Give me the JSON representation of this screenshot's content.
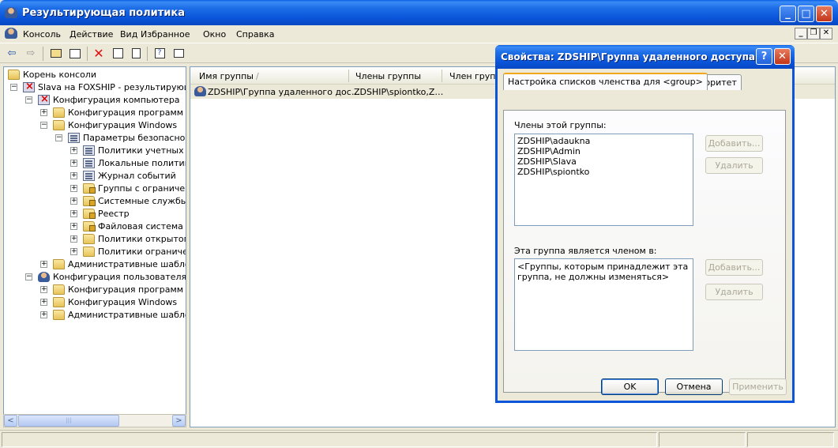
{
  "window": {
    "title": "Результирующая политика",
    "controls": [
      "_",
      "□",
      "✕"
    ]
  },
  "menubar": {
    "items": [
      "Консоль",
      "Действие",
      "Вид",
      "Избранное",
      "Окно",
      "Справка"
    ],
    "mdi_controls": [
      "_",
      "❐",
      "✕"
    ]
  },
  "toolbar": {
    "icons": [
      "back-arrow-icon",
      "forward-arrow-icon",
      "up-folder-icon",
      "show-tree-icon",
      "delete-icon",
      "properties-icon",
      "export-icon",
      "help-icon",
      "console-view-icon"
    ]
  },
  "tree": {
    "nodes": [
      {
        "label": "Корень консоли",
        "icon": "folder",
        "level": 0,
        "expander": ""
      },
      {
        "label": "Slava на FOXSHIP - результирующая",
        "icon": "pc-red",
        "level": 0,
        "expander": "−"
      },
      {
        "label": "Конфигурация компьютера",
        "icon": "pc-red",
        "level": 1,
        "expander": "−"
      },
      {
        "label": "Конфигурация программ",
        "icon": "folder",
        "level": 2,
        "expander": "+"
      },
      {
        "label": "Конфигурация Windows",
        "icon": "folder",
        "level": 2,
        "expander": "−"
      },
      {
        "label": "Параметры безопасности",
        "icon": "policy",
        "level": 3,
        "expander": "−"
      },
      {
        "label": "Политики учетных за",
        "icon": "policy",
        "level": 4,
        "expander": "+"
      },
      {
        "label": "Локальные политики",
        "icon": "policy",
        "level": 4,
        "expander": "+"
      },
      {
        "label": "Журнал событий",
        "icon": "policy",
        "level": 4,
        "expander": "+"
      },
      {
        "label": "Группы с ограниченн",
        "icon": "folder-lock",
        "level": 4,
        "expander": "+"
      },
      {
        "label": "Системные службы",
        "icon": "folder-lock",
        "level": 4,
        "expander": "+"
      },
      {
        "label": "Реестр",
        "icon": "folder-lock",
        "level": 4,
        "expander": "+"
      },
      {
        "label": "Файловая система",
        "icon": "folder-lock",
        "level": 4,
        "expander": "+"
      },
      {
        "label": "Политики открытого",
        "icon": "folder",
        "level": 4,
        "expander": "+"
      },
      {
        "label": "Политики ограничен",
        "icon": "folder",
        "level": 4,
        "expander": "+"
      },
      {
        "label": "Административные шаблоны",
        "icon": "folder",
        "level": 2,
        "expander": "+"
      },
      {
        "label": "Конфигурация пользователя",
        "icon": "user",
        "level": 1,
        "expander": "−"
      },
      {
        "label": "Конфигурация программ",
        "icon": "folder",
        "level": 2,
        "expander": "+"
      },
      {
        "label": "Конфигурация Windows",
        "icon": "folder",
        "level": 2,
        "expander": "+"
      },
      {
        "label": "Административные шаблоны",
        "icon": "folder",
        "level": 2,
        "expander": "+"
      }
    ],
    "scroll_left": "<",
    "scroll_right": ">",
    "scroll_thumb_grip": "|||"
  },
  "list": {
    "columns": [
      "Имя группы",
      "Члены группы",
      "Член групп"
    ],
    "sort_indicator": "/",
    "rows": [
      {
        "name": "ZDSHIP\\Группа удаленного дос…",
        "members": "ZDSHIP\\spiontko,Z…"
      }
    ]
  },
  "dialog": {
    "title": "Свойства: ZDSHIP\\Группа удаленного доступа",
    "help_button": "?",
    "close_button": "✕",
    "tabs": [
      "Настройка списков членства для <group>",
      "Приоритет"
    ],
    "members_label": "Члены этой группы:",
    "members": [
      "ZDSHIP\\adaukna",
      "ZDSHIP\\Admin",
      "ZDSHIP\\Slava",
      "ZDSHIP\\spiontko"
    ],
    "member_of_label": "Эта группа является членом в:",
    "member_of_text": [
      "<Группы, которым принадлежит эта",
      "группа, не должны изменяться>"
    ],
    "add_label": "Добавить...",
    "remove_label": "Удалить",
    "ok_label": "OK",
    "cancel_label": "Отмена",
    "apply_label": "Применить"
  }
}
